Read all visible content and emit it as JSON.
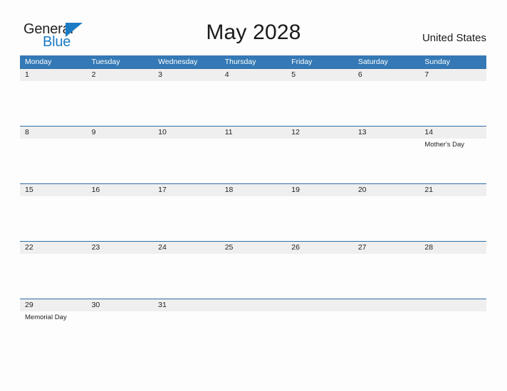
{
  "brand": {
    "name_part1": "General",
    "name_part2": "Blue",
    "mark": "triangle-flag-icon",
    "accent_color": "#1a7ac4"
  },
  "header": {
    "title": "May 2028",
    "country": "United States"
  },
  "colors": {
    "weekday_header_bg": "#3479b5",
    "week_rule": "#2e6da4",
    "day_band_bg": "#efefef",
    "text": "#222222"
  },
  "calendar": {
    "month": "May",
    "year": "2028",
    "weekday_headers": [
      {
        "label": "Monday"
      },
      {
        "label": "Tuesday"
      },
      {
        "label": "Wednesday"
      },
      {
        "label": "Thursday"
      },
      {
        "label": "Friday"
      },
      {
        "label": "Saturday"
      },
      {
        "label": "Sunday"
      }
    ],
    "weeks": [
      {
        "days": [
          {
            "num": "1",
            "events": []
          },
          {
            "num": "2",
            "events": []
          },
          {
            "num": "3",
            "events": []
          },
          {
            "num": "4",
            "events": []
          },
          {
            "num": "5",
            "events": []
          },
          {
            "num": "6",
            "events": []
          },
          {
            "num": "7",
            "events": []
          }
        ]
      },
      {
        "days": [
          {
            "num": "8",
            "events": []
          },
          {
            "num": "9",
            "events": []
          },
          {
            "num": "10",
            "events": []
          },
          {
            "num": "11",
            "events": []
          },
          {
            "num": "12",
            "events": []
          },
          {
            "num": "13",
            "events": []
          },
          {
            "num": "14",
            "events": [
              {
                "name": "Mother's Day"
              }
            ]
          }
        ]
      },
      {
        "days": [
          {
            "num": "15",
            "events": []
          },
          {
            "num": "16",
            "events": []
          },
          {
            "num": "17",
            "events": []
          },
          {
            "num": "18",
            "events": []
          },
          {
            "num": "19",
            "events": []
          },
          {
            "num": "20",
            "events": []
          },
          {
            "num": "21",
            "events": []
          }
        ]
      },
      {
        "days": [
          {
            "num": "22",
            "events": []
          },
          {
            "num": "23",
            "events": []
          },
          {
            "num": "24",
            "events": []
          },
          {
            "num": "25",
            "events": []
          },
          {
            "num": "26",
            "events": []
          },
          {
            "num": "27",
            "events": []
          },
          {
            "num": "28",
            "events": []
          }
        ]
      },
      {
        "days": [
          {
            "num": "29",
            "events": [
              {
                "name": "Memorial Day"
              }
            ]
          },
          {
            "num": "30",
            "events": []
          },
          {
            "num": "31",
            "events": []
          },
          {
            "num": "",
            "events": []
          },
          {
            "num": "",
            "events": []
          },
          {
            "num": "",
            "events": []
          },
          {
            "num": "",
            "events": []
          }
        ]
      }
    ]
  }
}
